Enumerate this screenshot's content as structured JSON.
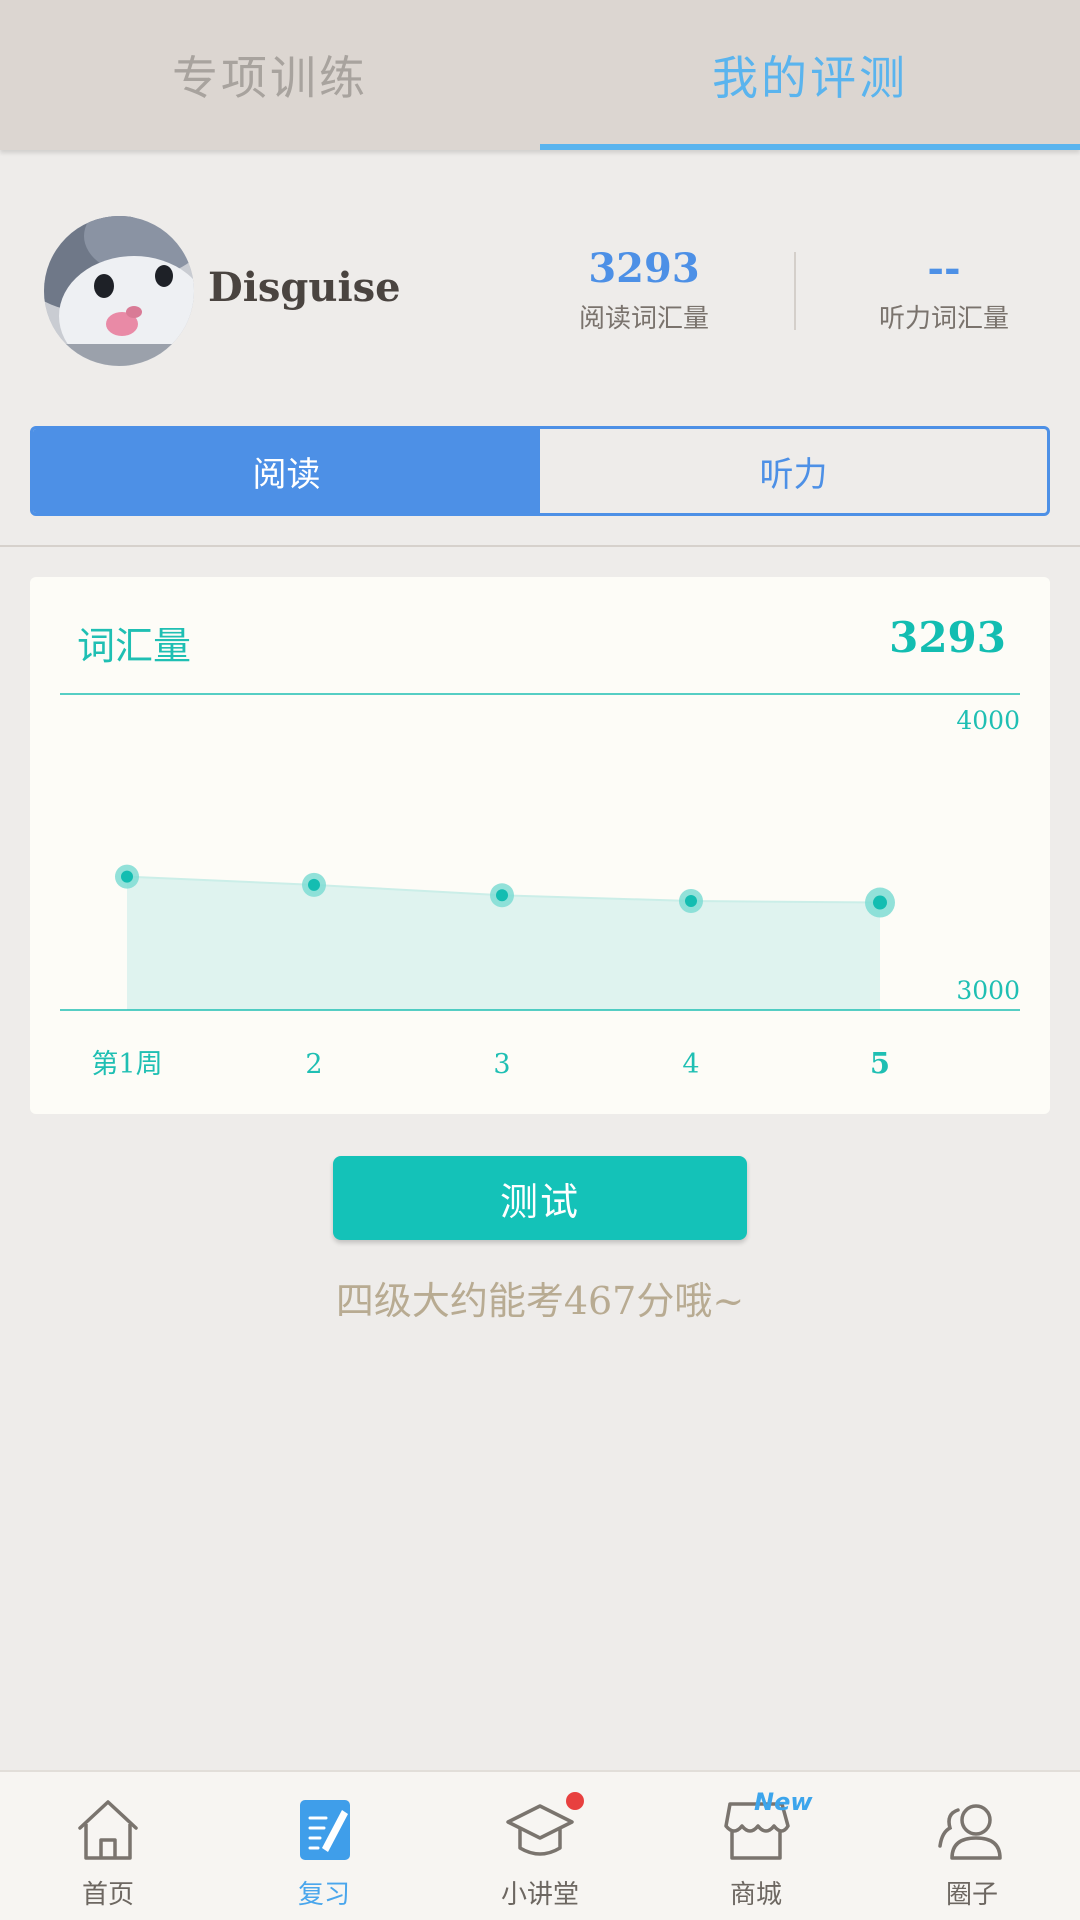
{
  "top_tabs": [
    {
      "label": "专项训练",
      "active": false
    },
    {
      "label": "我的评测",
      "active": true
    }
  ],
  "profile": {
    "username": "Disguise",
    "reading_value": "3293",
    "reading_label": "阅读词汇量",
    "listening_value": "--",
    "listening_label": "听力词汇量"
  },
  "segment": [
    {
      "label": "阅读",
      "active": true
    },
    {
      "label": "听力",
      "active": false
    }
  ],
  "card": {
    "title": "词汇量",
    "value": "3293"
  },
  "chart_data": {
    "type": "area",
    "categories": [
      "第1周",
      "2",
      "3",
      "4",
      "5"
    ],
    "values": [
      3422,
      3396,
      3363,
      3345,
      3340
    ],
    "ylim": [
      3000,
      4000
    ],
    "ytick_labels": [
      "4000",
      "3000"
    ],
    "grid": false,
    "colors": {
      "line": "#1fbfb3",
      "fill": "#dff3ef",
      "point": "#14bdb1",
      "halo": "#7fdcd3"
    }
  },
  "test_button": {
    "label": "测试"
  },
  "hint": "四级大约能考467分哦~",
  "bottom_nav": [
    {
      "label": "首页",
      "icon": "home-icon",
      "active": false
    },
    {
      "label": "复习",
      "icon": "review-icon",
      "active": true
    },
    {
      "label": "小讲堂",
      "icon": "graduation-cap-icon",
      "active": false,
      "badge": "dot"
    },
    {
      "label": "商城",
      "icon": "shop-icon",
      "active": false,
      "badge": "New"
    },
    {
      "label": "圈子",
      "icon": "people-icon",
      "active": false
    }
  ]
}
